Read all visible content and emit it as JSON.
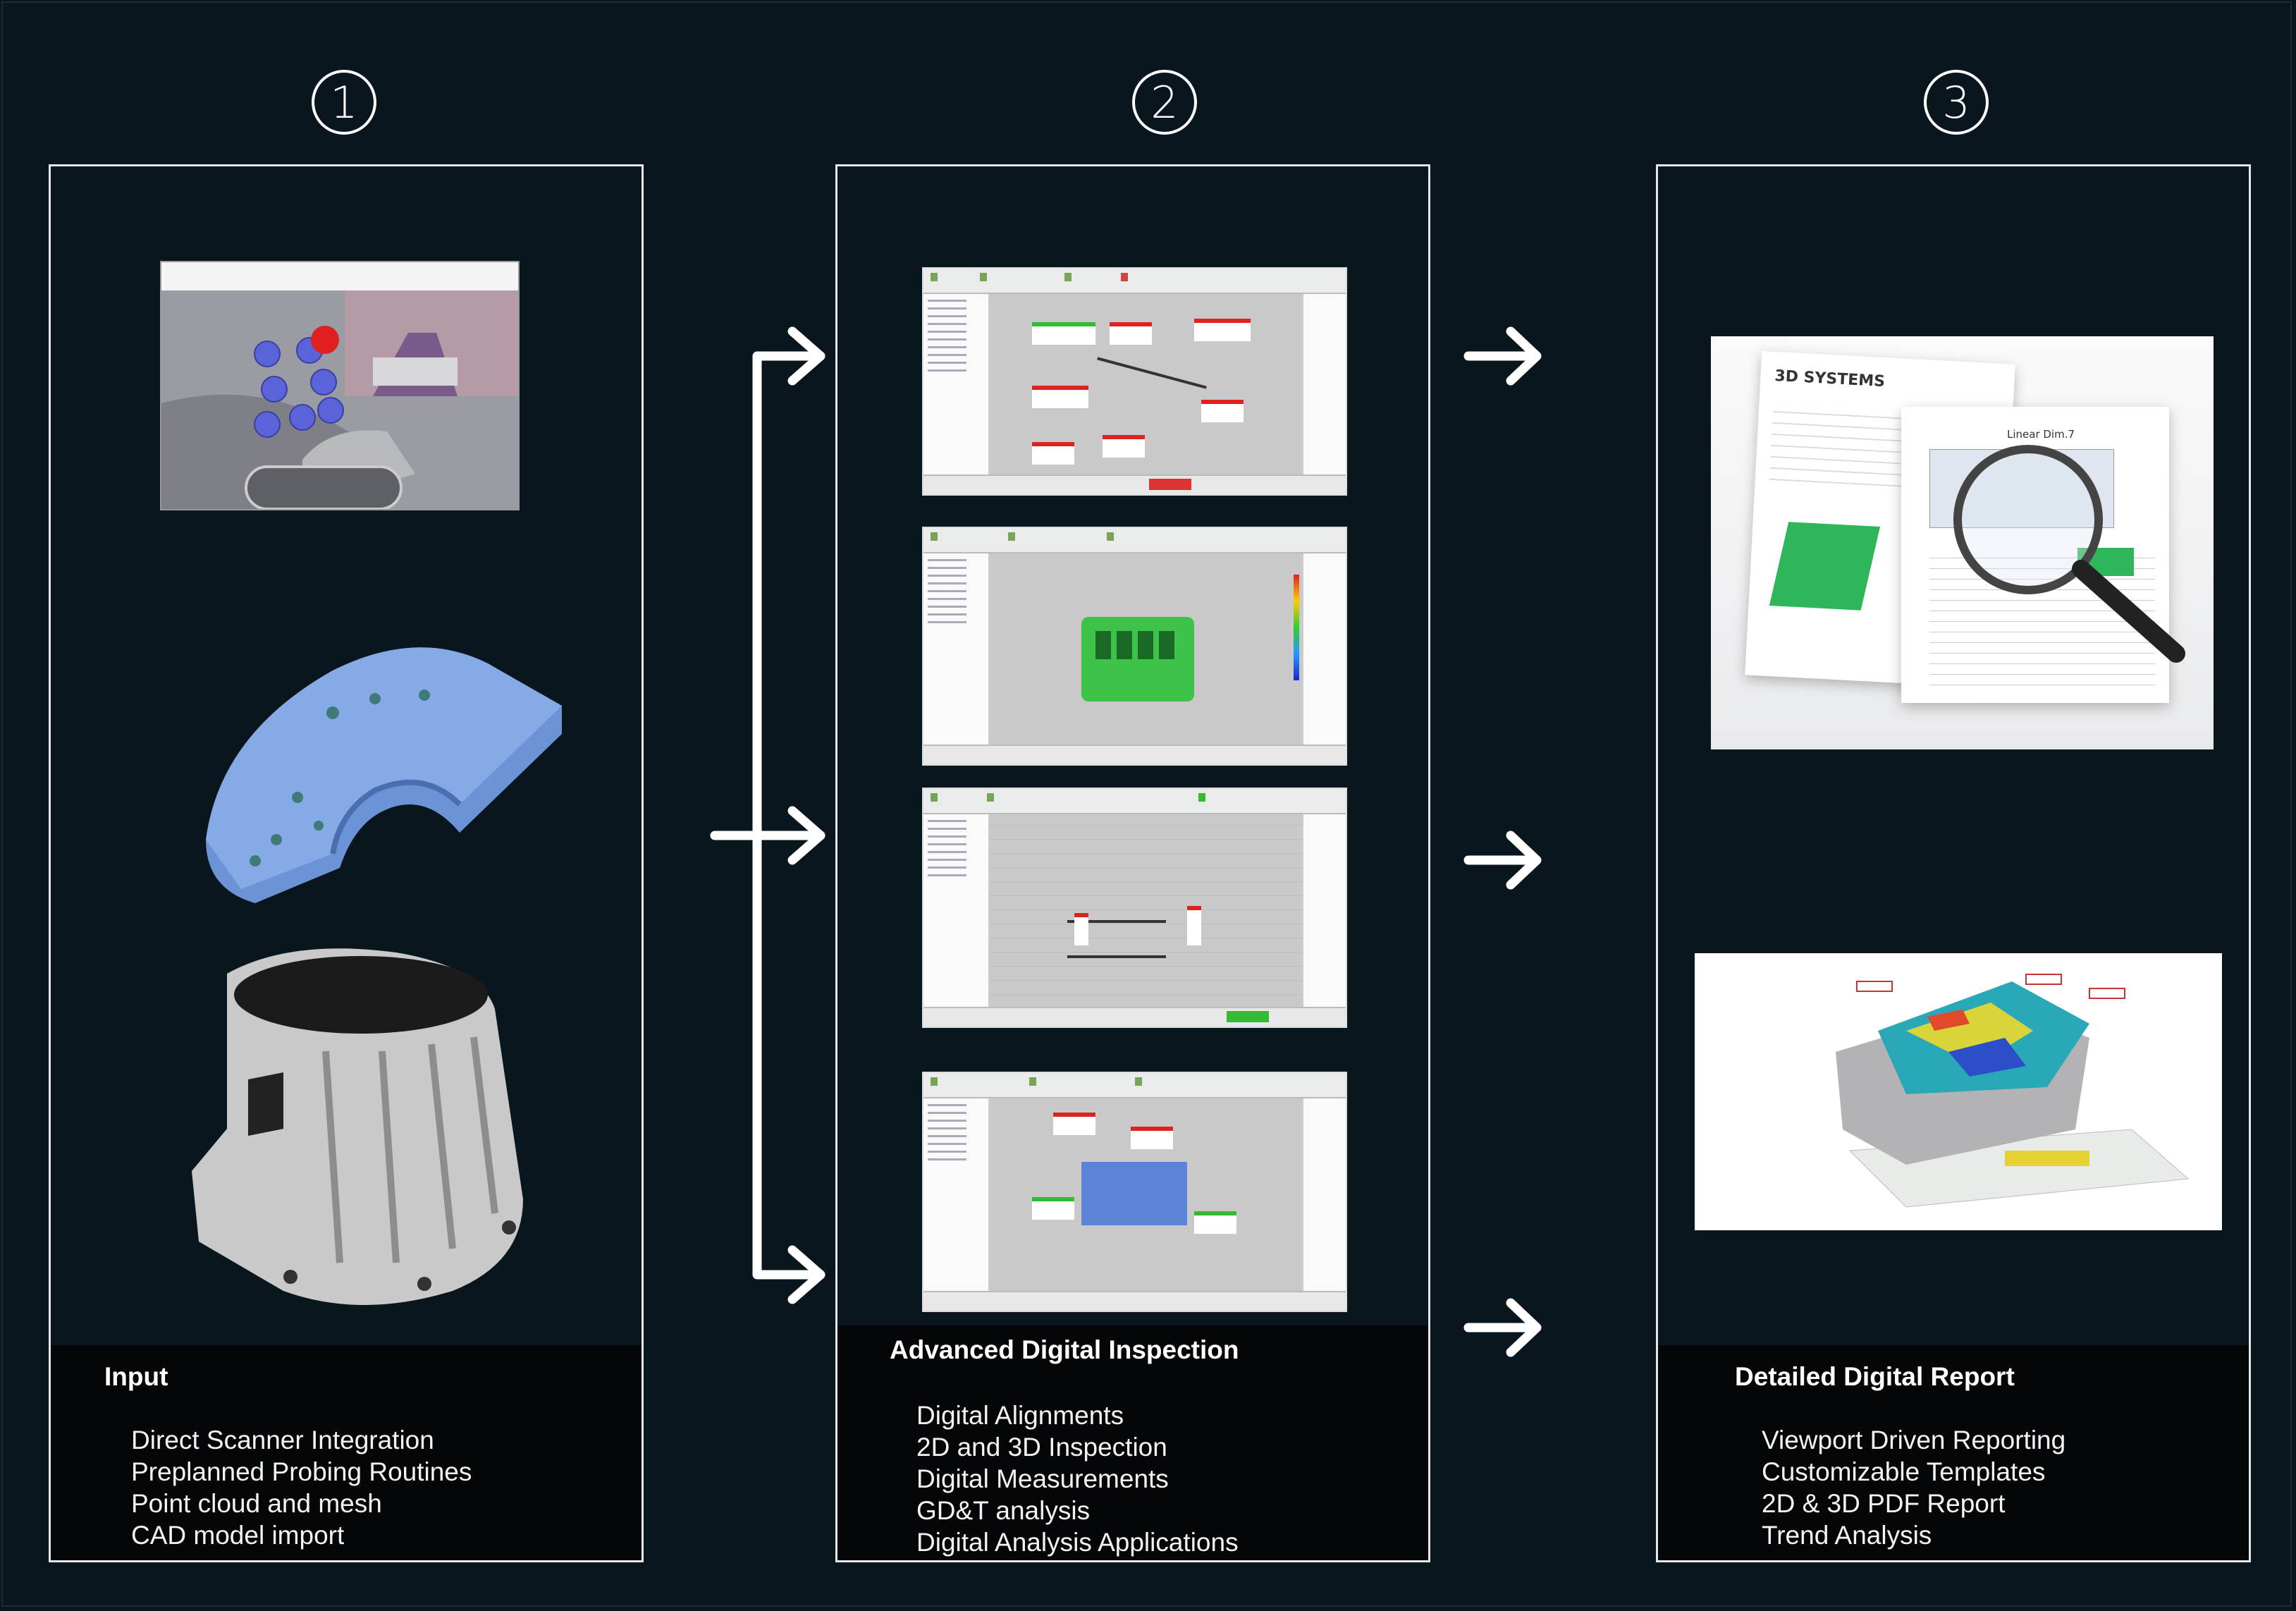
{
  "steps": [
    {
      "number": "1",
      "title": "Input",
      "items": [
        "Direct Scanner Integration",
        "Preplanned Probing Routines",
        "Point cloud and mesh",
        "CAD model import"
      ]
    },
    {
      "number": "2",
      "title": "Advanced Digital Inspection",
      "items": [
        "Digital Alignments",
        "2D and 3D Inspection",
        "Digital Measurements",
        "GD&T analysis",
        "Digital Analysis Applications"
      ]
    },
    {
      "number": "3",
      "title": "Detailed Digital Report",
      "items": [
        "Viewport Driven Reporting",
        "Customizable Templates",
        "2D & 3D PDF Report",
        "Trend Analysis"
      ],
      "report_logo": "3D SYSTEMS",
      "report_chart_title": "Linear Dim.7"
    }
  ],
  "colors": {
    "background": "#0a161e",
    "caption_background": "#050607",
    "panel_border": "#e6e6e6",
    "arrow": "#ffffff",
    "cad_part_blue": "#6b93d6"
  },
  "icons": [
    "arrow-right-icon",
    "bracket-arrow-icon"
  ]
}
